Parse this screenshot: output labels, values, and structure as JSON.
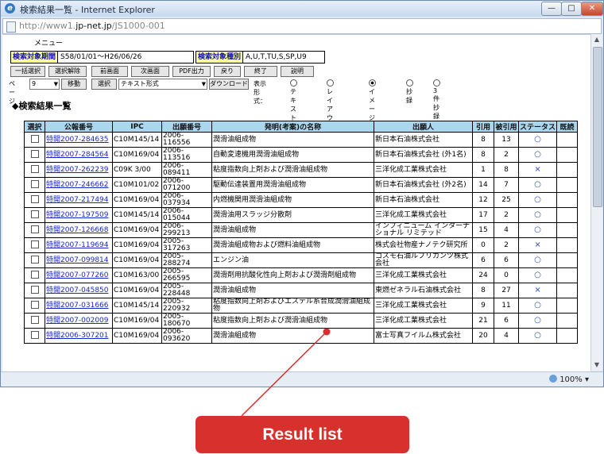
{
  "window": {
    "title": "検索結果一覧 - Internet Explorer",
    "ie_icon": "e",
    "minimize": "—",
    "maximize": "□",
    "close": "✕"
  },
  "address": {
    "prefix": "http://www1.",
    "domain": "jp-net.jp",
    "path": "/JS1000-001"
  },
  "page": {
    "menu_label": "メニュー",
    "period_label": "検索対象期間",
    "period_value": "S58/01/01～H26/06/26",
    "type_label": "検索対象種別",
    "type_value": "A,U,T,TU,S,SP,U9",
    "buttons": [
      "一括選択",
      "選択解除",
      "前画面",
      "次画面",
      "PDF出力",
      "戻り",
      "終了",
      "説明"
    ],
    "page_label": "ページ",
    "page_value": "9",
    "move_button": "移動",
    "select_button": "選択",
    "format_value": "テキスト形式",
    "download_button": "ダウンロード",
    "display_label": "表示形式：",
    "display_options": [
      "テキスト",
      "レイアウト",
      "イメージ",
      "抄録",
      "3件抄録"
    ],
    "display_selected": "イメージ",
    "heading": "◆検索結果一覧"
  },
  "table": {
    "headers": [
      "選択",
      "公報番号",
      "IPC",
      "出願番号",
      "発明(考案)の名称",
      "出願人",
      "引用",
      "被引用",
      "ステータス",
      "既読"
    ],
    "rows": [
      {
        "pub": "特開2007-284635",
        "ipc": "C10M145/14",
        "app": "2006-116556",
        "title": "潤滑油組成物",
        "applicant": "新日本石油株式会社",
        "cited": "8",
        "citing": "13",
        "status": "○"
      },
      {
        "pub": "特開2007-284564",
        "ipc": "C10M169/04",
        "app": "2006-113516",
        "title": "自動変速機用潤滑油組成物",
        "applicant": "新日本石油株式会社 (外1名)",
        "cited": "8",
        "citing": "2",
        "status": "○"
      },
      {
        "pub": "特開2007-262239",
        "ipc": "C09K 3/00",
        "app": "2006-089411",
        "title": "粘度指数向上剤および潤滑油組成物",
        "applicant": "三洋化成工業株式会社",
        "cited": "1",
        "citing": "8",
        "status": "×"
      },
      {
        "pub": "特開2007-246662",
        "ipc": "C10M101/02",
        "app": "2006-071200",
        "title": "駆動伝達装置用潤滑油組成物",
        "applicant": "新日本石油株式会社 (外2名)",
        "cited": "14",
        "citing": "7",
        "status": "○"
      },
      {
        "pub": "特開2007-217494",
        "ipc": "C10M169/04",
        "app": "2006-037934",
        "title": "内燃機関用潤滑油組成物",
        "applicant": "新日本石油株式会社",
        "cited": "12",
        "citing": "25",
        "status": "○"
      },
      {
        "pub": "特開2007-197509",
        "ipc": "C10M145/14",
        "app": "2006-015044",
        "title": "潤滑油用スラッジ分散剤",
        "applicant": "三洋化成工業株式会社",
        "cited": "17",
        "citing": "2",
        "status": "○"
      },
      {
        "pub": "特開2007-126668",
        "ipc": "C10M169/04",
        "app": "2006-299213",
        "title": "潤滑油組成物",
        "applicant": "インフィニューム インターナショナル リミテッド",
        "cited": "15",
        "citing": "4",
        "status": "○"
      },
      {
        "pub": "特開2007-119694",
        "ipc": "C10M169/04",
        "app": "2005-317263",
        "title": "潤滑油組成物および燃料油組成物",
        "applicant": "株式会社物産ナノテク研究所",
        "cited": "0",
        "citing": "2",
        "status": "×"
      },
      {
        "pub": "特開2007-099814",
        "ipc": "C10M169/04",
        "app": "2005-288274",
        "title": "エンジン油",
        "applicant": "コスモ石油ルブリカンツ株式会社",
        "cited": "6",
        "citing": "6",
        "status": "○"
      },
      {
        "pub": "特開2007-077260",
        "ipc": "C10M163/00",
        "app": "2005-266595",
        "title": "潤滑剤用抗酸化性向上剤および潤滑剤組成物",
        "applicant": "三洋化成工業株式会社",
        "cited": "24",
        "citing": "0",
        "status": "○"
      },
      {
        "pub": "特開2007-045850",
        "ipc": "C10M169/04",
        "app": "2005-228448",
        "title": "潤滑油組成物",
        "applicant": "東燃ゼネラル石油株式会社",
        "cited": "8",
        "citing": "27",
        "status": "×"
      },
      {
        "pub": "特開2007-031666",
        "ipc": "C10M145/14",
        "app": "2005-220932",
        "title": "粘度指数向上剤およびエステル系合成潤滑油組成物",
        "applicant": "三洋化成工業株式会社",
        "cited": "9",
        "citing": "11",
        "status": "○"
      },
      {
        "pub": "特開2007-002009",
        "ipc": "C10M169/04",
        "app": "2005-180670",
        "title": "粘度指数向上剤および潤滑油組成物",
        "applicant": "三洋化成工業株式会社",
        "cited": "21",
        "citing": "6",
        "status": "○"
      },
      {
        "pub": "特開2006-307201",
        "ipc": "C10M169/04",
        "app": "2006-093620",
        "title": "潤滑油組成物",
        "applicant": "富士写真フイルム株式会社",
        "cited": "20",
        "citing": "4",
        "status": "○"
      }
    ]
  },
  "status_bar": {
    "zoom": "100%",
    "zoom_arrow": "▾"
  },
  "annotation": {
    "label": "Result list"
  }
}
